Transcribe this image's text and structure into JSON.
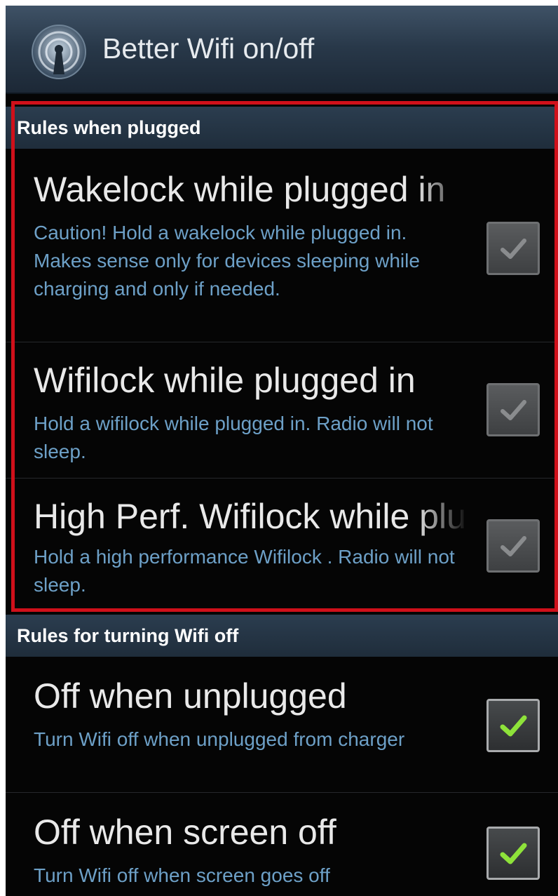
{
  "app": {
    "title": "Better Wifi on/off",
    "icon": "wifi-antenna-icon"
  },
  "sections": [
    {
      "header": "Rules when plugged",
      "highlighted": true,
      "items": [
        {
          "title": "Wakelock while plugged in",
          "summary": "Caution! Hold a wakelock while plugged in. Makes sense only for devices sleeping while charging and only if needed.",
          "checked": true,
          "enabled": false
        },
        {
          "title": "Wifilock while plugged in",
          "summary": "Hold a wifilock while plugged in. Radio will not sleep.",
          "checked": true,
          "enabled": false
        },
        {
          "title": "High Perf. Wifilock while plugged in",
          "summary": "Hold a high performance Wifilock . Radio will not sleep.",
          "checked": true,
          "enabled": false
        }
      ]
    },
    {
      "header": "Rules for turning Wifi off",
      "highlighted": false,
      "items": [
        {
          "title": "Off when unplugged",
          "summary": "Turn Wifi off when unplugged from charger",
          "checked": true,
          "enabled": true
        },
        {
          "title": "Off when screen off",
          "summary": "Turn Wifi off when screen goes off",
          "checked": true,
          "enabled": true
        }
      ]
    }
  ],
  "colors": {
    "highlight_border": "#d0101a",
    "summary_text": "#6da0c7",
    "check_active": "#8ee23a",
    "check_disabled": "#8a8c8e"
  }
}
